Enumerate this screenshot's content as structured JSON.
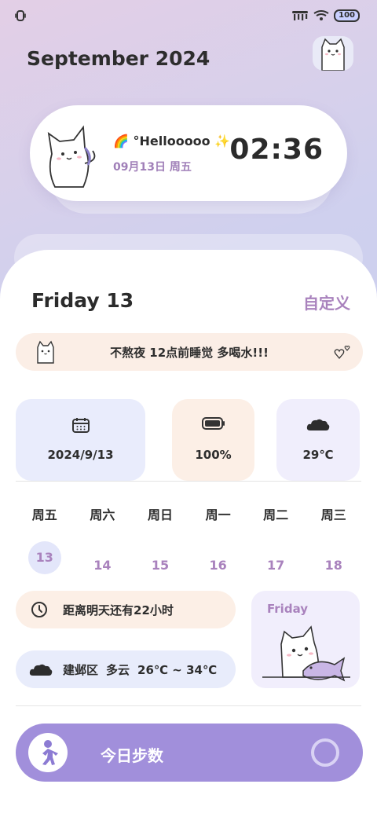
{
  "status_bar": {
    "battery_level": "100",
    "icons": [
      "notification-icon",
      "signal-icon",
      "wifi-icon",
      "battery-icon"
    ]
  },
  "header": {
    "month_title": "September 2024"
  },
  "hello_card": {
    "greeting": "🌈 °Hellooooo ✨",
    "date": "09月13日 周五",
    "time": "02:36"
  },
  "main": {
    "day_title": "Friday 13",
    "customize_label": "自定义"
  },
  "note": {
    "text": "不熬夜 12点前睡觉 多喝水!!!"
  },
  "info_cards": {
    "date": "2024/9/13",
    "battery": "100%",
    "temperature": "29℃"
  },
  "week": {
    "labels": [
      "周五",
      "周六",
      "周日",
      "周一",
      "周二",
      "周三"
    ],
    "days": [
      "13",
      "14",
      "15",
      "16",
      "17",
      "18"
    ]
  },
  "countdown": {
    "text": "距离明天还有22小时"
  },
  "weather": {
    "district": "建邺区",
    "condition": "多云",
    "temp_range": "26℃  ~ 34℃"
  },
  "friday_card": {
    "label": "Friday"
  },
  "steps": {
    "label": "今日步数"
  },
  "colors": {
    "accent": "#a982bd",
    "steps_bar": "#a18fdb",
    "note_bg": "#fbeee6"
  }
}
